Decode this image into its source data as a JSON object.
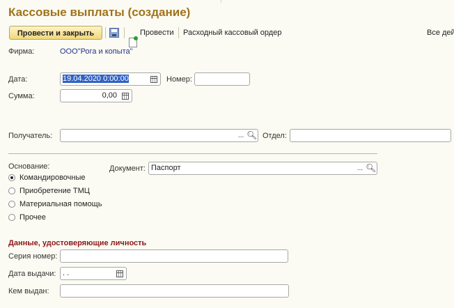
{
  "window": {
    "title": "Кассовые выплаты (создание)"
  },
  "toolbar": {
    "post_close_label": "Провести и закрыть",
    "save_icon": "save-icon",
    "post_icon": "post-icon",
    "post_label": "Провести",
    "cash_order_label": "Расходный кассовый ордер",
    "all_actions_label": "Все дей"
  },
  "form": {
    "firm_label": "Фирма:",
    "firm_value": "ООО\"Рога и копыта\"",
    "date_label": "Дата:",
    "date_value": "19.04.2020  0:00:00",
    "number_label": "Номер:",
    "number_value": "",
    "sum_label": "Сумма:",
    "sum_value": "0,00",
    "recipient_label": "Получатель:",
    "recipient_value": "",
    "department_label": "Отдел:",
    "department_value": "",
    "basis_label": "Основание:",
    "basis_options": [
      "Командировочные",
      "Приобретение ТМЦ",
      "Материальная помощь",
      "Прочее"
    ],
    "basis_selected": "Командировочные",
    "document_label": "Документ:",
    "document_value": "Паспорт",
    "select_button_label": "...",
    "search_icon": "search-icon",
    "calendar_icon": "calendar-icon",
    "calculator_icon": "calculator-icon"
  },
  "identity": {
    "section_title": "Данные, удостоверяющие личность",
    "series_label": "Серия номер:",
    "series_value": "",
    "issue_date_label": "Дата выдачи:",
    "issue_date_value": " .  .",
    "issued_by_label": "Кем выдан:",
    "issued_by_value": ""
  },
  "colors": {
    "title": "#a0731a",
    "section_title": "#8c1818",
    "link": "#223388",
    "background": "#fbfbf3",
    "selection": "#3162c6"
  }
}
